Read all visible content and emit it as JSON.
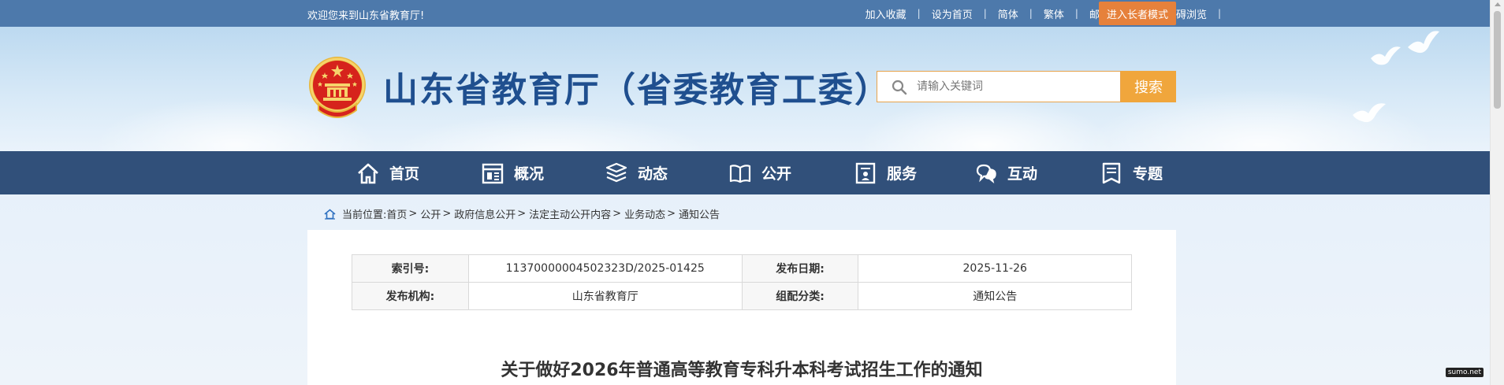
{
  "topbar": {
    "welcome": "欢迎您来到山东省教育厅!",
    "links": [
      "加入收藏",
      "设为首页",
      "简体",
      "繁体",
      "邮件系统",
      "无障碍浏览"
    ],
    "separator": "|",
    "elder_mode": "进入长者模式"
  },
  "header": {
    "title": "山东省教育厅（省委教育工委）",
    "search_placeholder": "请输入关键词",
    "search_button": "搜索"
  },
  "nav": {
    "items": [
      {
        "label": "首页",
        "icon": "home-icon"
      },
      {
        "label": "概况",
        "icon": "overview-icon"
      },
      {
        "label": "动态",
        "icon": "news-icon"
      },
      {
        "label": "公开",
        "icon": "book-icon"
      },
      {
        "label": "服务",
        "icon": "service-icon"
      },
      {
        "label": "互动",
        "icon": "chat-icon"
      },
      {
        "label": "专题",
        "icon": "topic-icon"
      }
    ]
  },
  "breadcrumb": {
    "prefix": "当前位置:",
    "items": [
      "首页",
      "公开",
      "政府信息公开",
      "法定主动公开内容",
      "业务动态",
      "通知公告"
    ],
    "separator": ">"
  },
  "meta": {
    "index_label": "索引号:",
    "index_value": "11370000004502323D/2025-01425",
    "date_label": "发布日期:",
    "date_value": "2025-11-26",
    "org_label": "发布机构:",
    "org_value": "山东省教育厅",
    "category_label": "组配分类:",
    "category_value": "通知公告"
  },
  "article": {
    "title": "关于做好2026年普通高等教育专科升本科考试招生工作的通知"
  },
  "watermark": "sumo.net",
  "colors": {
    "topbar": "#4d79ab",
    "nav": "#31507a",
    "title": "#1f4f8f",
    "search_button": "#f0a63c",
    "elder_button": "#e6813b"
  }
}
